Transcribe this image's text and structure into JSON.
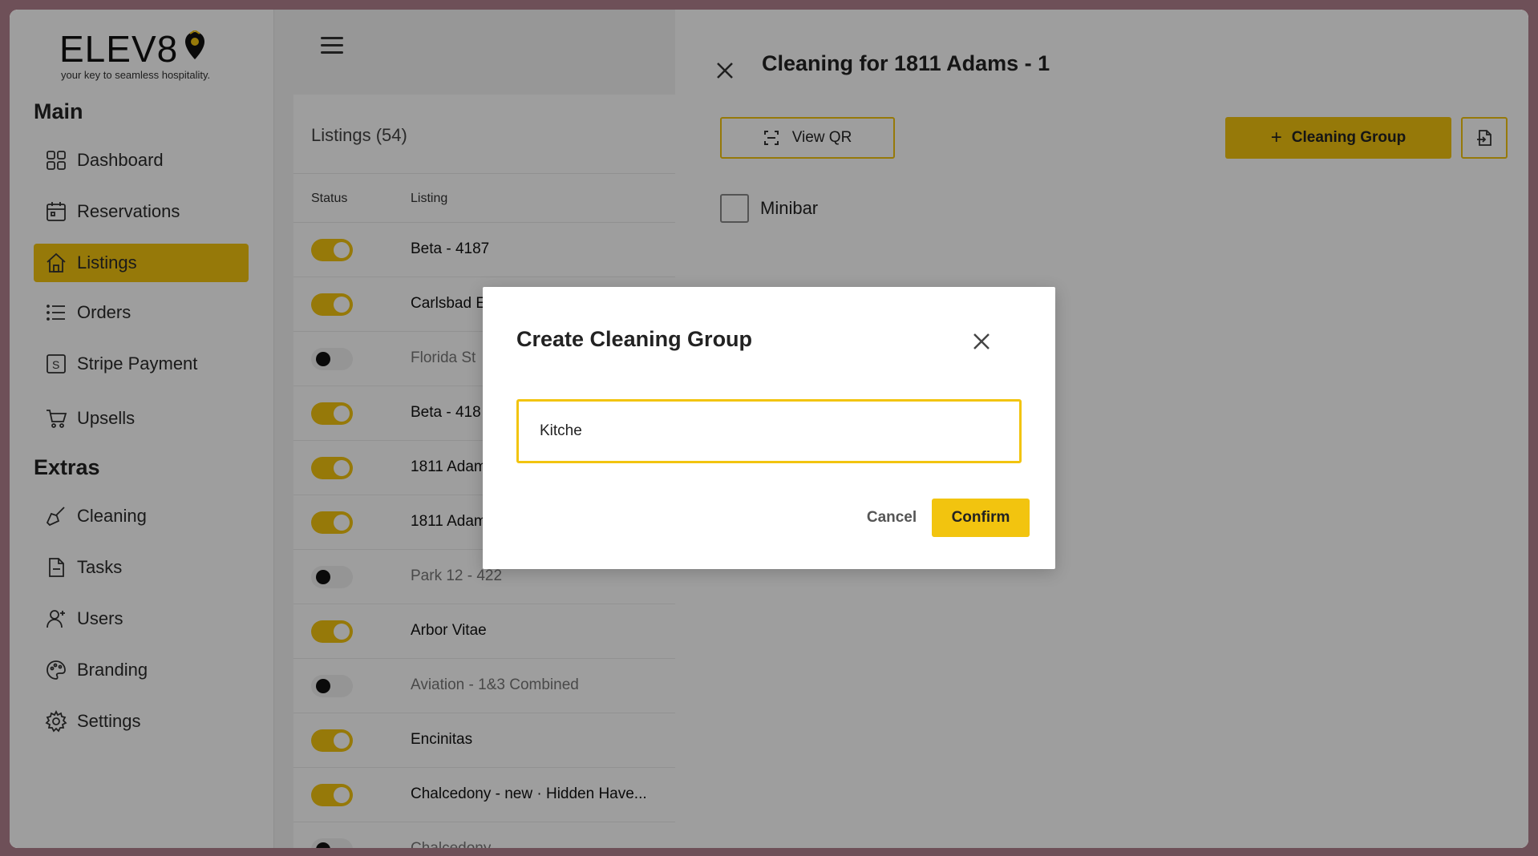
{
  "brand": {
    "logo_text": "ELEV8",
    "tagline": "your key to seamless hospitality.",
    "accent_color": "#f2c40f"
  },
  "sidebar": {
    "main_title": "Main",
    "extras_title": "Extras",
    "main_items": [
      {
        "label": "Dashboard",
        "icon": "grid-icon"
      },
      {
        "label": "Reservations",
        "icon": "calendar-icon"
      },
      {
        "label": "Listings",
        "icon": "home-icon",
        "active": true
      },
      {
        "label": "Orders",
        "icon": "list-icon"
      },
      {
        "label": "Stripe Payment",
        "icon": "stripe-icon"
      },
      {
        "label": "Upsells",
        "icon": "cart-icon"
      }
    ],
    "extras_items": [
      {
        "label": "Cleaning",
        "icon": "broom-icon"
      },
      {
        "label": "Tasks",
        "icon": "document-icon"
      },
      {
        "label": "Users",
        "icon": "user-plus-icon"
      },
      {
        "label": "Branding",
        "icon": "palette-icon"
      },
      {
        "label": "Settings",
        "icon": "gear-icon"
      }
    ]
  },
  "listings": {
    "title": "Listings (54)",
    "columns": {
      "status": "Status",
      "listing": "Listing"
    },
    "rows": [
      {
        "name": "Beta - 4187",
        "active": true
      },
      {
        "name": "Carlsbad E",
        "active": true
      },
      {
        "name": "Florida St",
        "active": false
      },
      {
        "name": "Beta - 418",
        "active": true
      },
      {
        "name": "1811 Adam",
        "active": true
      },
      {
        "name": "1811 Adam",
        "active": true
      },
      {
        "name": "Park 12 - 422",
        "active": false
      },
      {
        "name": "Arbor Vitae",
        "active": true
      },
      {
        "name": "Aviation - 1&3 Combined",
        "active": false
      },
      {
        "name": "Encinitas",
        "active": true
      },
      {
        "name": "Chalcedony - new · Hidden Have...",
        "active": true
      },
      {
        "name": "Chalcedony",
        "active": false
      }
    ]
  },
  "drawer": {
    "title": "Cleaning for 1811 Adams - 1",
    "view_qr_label": "View QR",
    "cleaning_group_label": "Cleaning Group",
    "checkbox_label": "Minibar"
  },
  "modal": {
    "title": "Create Cleaning Group",
    "input_value": "Kitche",
    "cancel_label": "Cancel",
    "confirm_label": "Confirm"
  }
}
